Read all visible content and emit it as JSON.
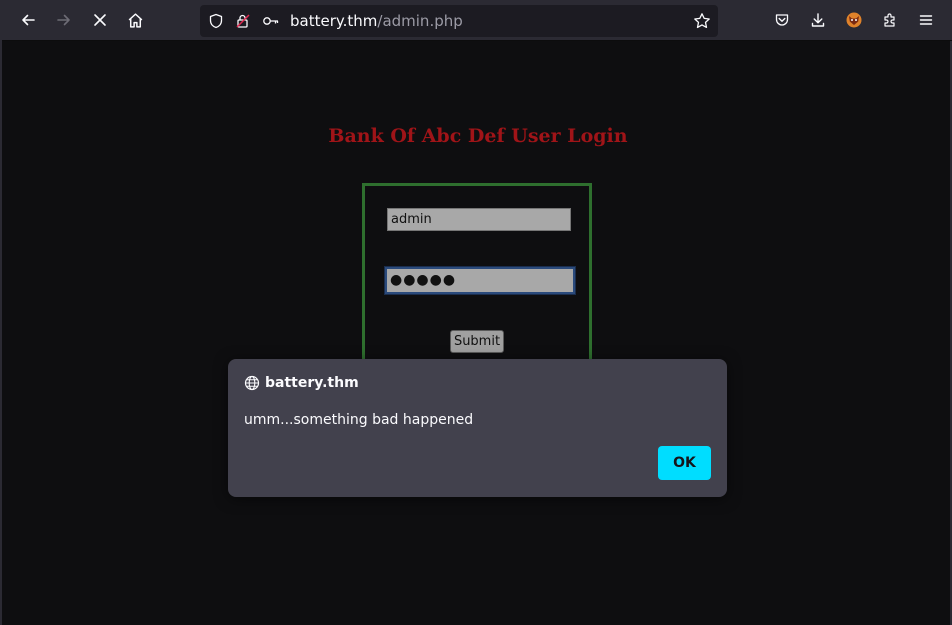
{
  "browser": {
    "url_host": "battery.thm",
    "url_path": "/admin.php",
    "icons": [
      "back-arrow-icon",
      "forward-arrow-icon",
      "stop-loading-icon",
      "home-icon",
      "shield-icon",
      "permissions-icon",
      "key-icon",
      "bookmark-star-icon",
      "pocket-icon",
      "download-icon",
      "extension-fox-icon",
      "puzzle-icon",
      "hamburger-menu-icon"
    ]
  },
  "page": {
    "title": "Bank Of Abc Def User Login",
    "username_value": "admin",
    "password_value": "●●●●●",
    "submit_label": "Submit"
  },
  "dialog": {
    "origin": "battery.thm",
    "message": "umm...something bad happened",
    "ok_label": "OK"
  },
  "colors": {
    "page_bg": "#0e0e10",
    "title_red": "#a01418",
    "box_border_green": "#2e6f2e",
    "accent_cyan": "#00ddff",
    "dialog_bg": "#42414d",
    "toolbar_bg": "#2b2a33"
  }
}
